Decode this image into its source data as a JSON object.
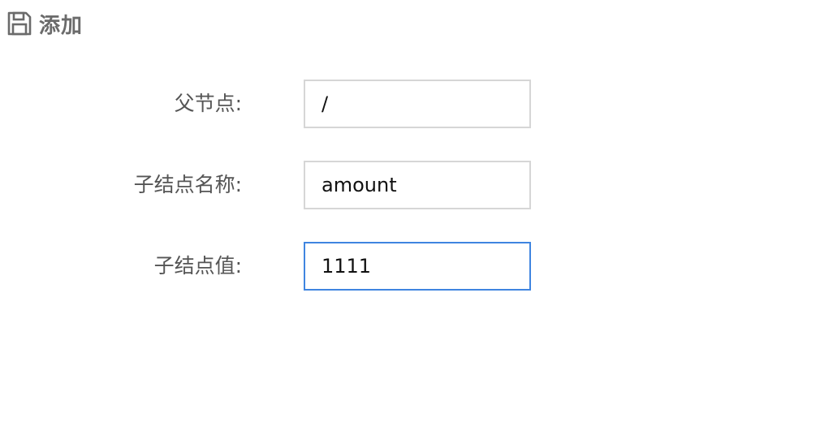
{
  "toolbar": {
    "add_label": "添加",
    "add_icon": "save-icon"
  },
  "form": {
    "parent_node": {
      "label": "父节点:",
      "value": "/"
    },
    "child_name": {
      "label": "子结点名称:",
      "value": "amount"
    },
    "child_value": {
      "label": "子结点值:",
      "value": "1111"
    }
  },
  "colors": {
    "label_text": "#555555",
    "input_border": "#d6d6d6",
    "focus_border": "#3f85e0",
    "toolbar_text": "#6b6b6b"
  }
}
